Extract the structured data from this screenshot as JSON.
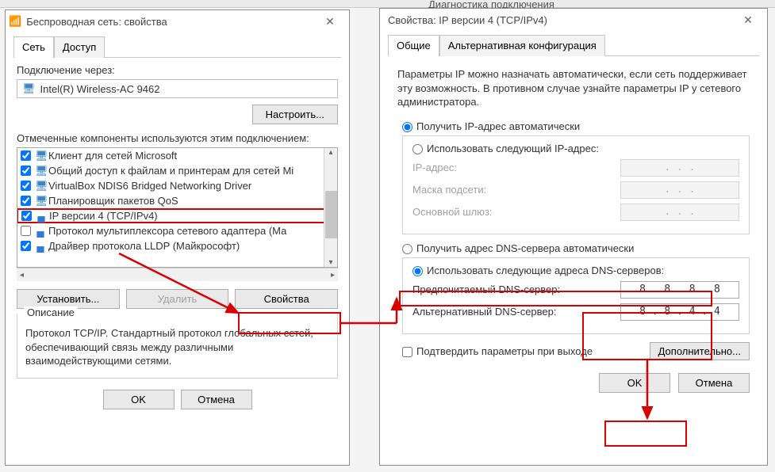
{
  "bg_tabs": [
    "",
    "",
    "Диагностика подключения"
  ],
  "left": {
    "title": "Беспроводная сеть: свойства",
    "tabs": [
      "Сеть",
      "Доступ"
    ],
    "connect_via_label": "Подключение через:",
    "adapter": "Intel(R) Wireless-AC 9462",
    "configure_btn": "Настроить...",
    "components_label": "Отмеченные компоненты используются этим подключением:",
    "components": [
      {
        "chk": true,
        "icon": "mon",
        "text": "Клиент для сетей Microsoft"
      },
      {
        "chk": true,
        "icon": "mon",
        "text": "Общий доступ к файлам и принтерам для сетей Mi"
      },
      {
        "chk": true,
        "icon": "mon",
        "text": "VirtualBox NDIS6 Bridged Networking Driver"
      },
      {
        "chk": true,
        "icon": "mon",
        "text": "Планировщик пакетов QoS"
      },
      {
        "chk": true,
        "icon": "net",
        "text": "IP версии 4 (TCP/IPv4)",
        "hl": true
      },
      {
        "chk": false,
        "icon": "net",
        "text": "Протокол мультиплексора сетевого адаптера (Ма"
      },
      {
        "chk": true,
        "icon": "net",
        "text": "Драйвер протокола LLDP (Майкрософт)"
      }
    ],
    "install_btn": "Установить...",
    "remove_btn": "Удалить",
    "props_btn": "Свойства",
    "desc_title": "Описание",
    "desc_text": "Протокол TCP/IP. Стандартный протокол глобальных сетей, обеспечивающий связь между различными взаимодействующими сетями.",
    "ok": "OK",
    "cancel": "Отмена"
  },
  "right": {
    "title": "Свойства: IP версии 4 (TCP/IPv4)",
    "tabs": [
      "Общие",
      "Альтернативная конфигурация"
    ],
    "intro": "Параметры IP можно назначать автоматически, если сеть поддерживает эту возможность. В противном случае узнайте параметры IP у сетевого администратора.",
    "ip_auto": "Получить IP-адрес автоматически",
    "ip_manual": "Использовать следующий IP-адрес:",
    "ip_label": "IP-адрес:",
    "mask_label": "Маска подсети:",
    "gw_label": "Основной шлюз:",
    "ip_dots": ".       .       .",
    "dns_auto": "Получить адрес DNS-сервера автоматически",
    "dns_manual": "Использовать следующие адреса DNS-серверов:",
    "dns_pref_label": "Предпочитаемый DNS-сервер:",
    "dns_alt_label": "Альтернативный DNS-сервер:",
    "dns_pref": "8  .  8  .  8  .  8",
    "dns_alt": "8  .  8  .  4  .  4",
    "confirm_exit": "Подтвердить параметры при выходе",
    "advanced": "Дополнительно...",
    "ok": "OK",
    "cancel": "Отмена"
  }
}
